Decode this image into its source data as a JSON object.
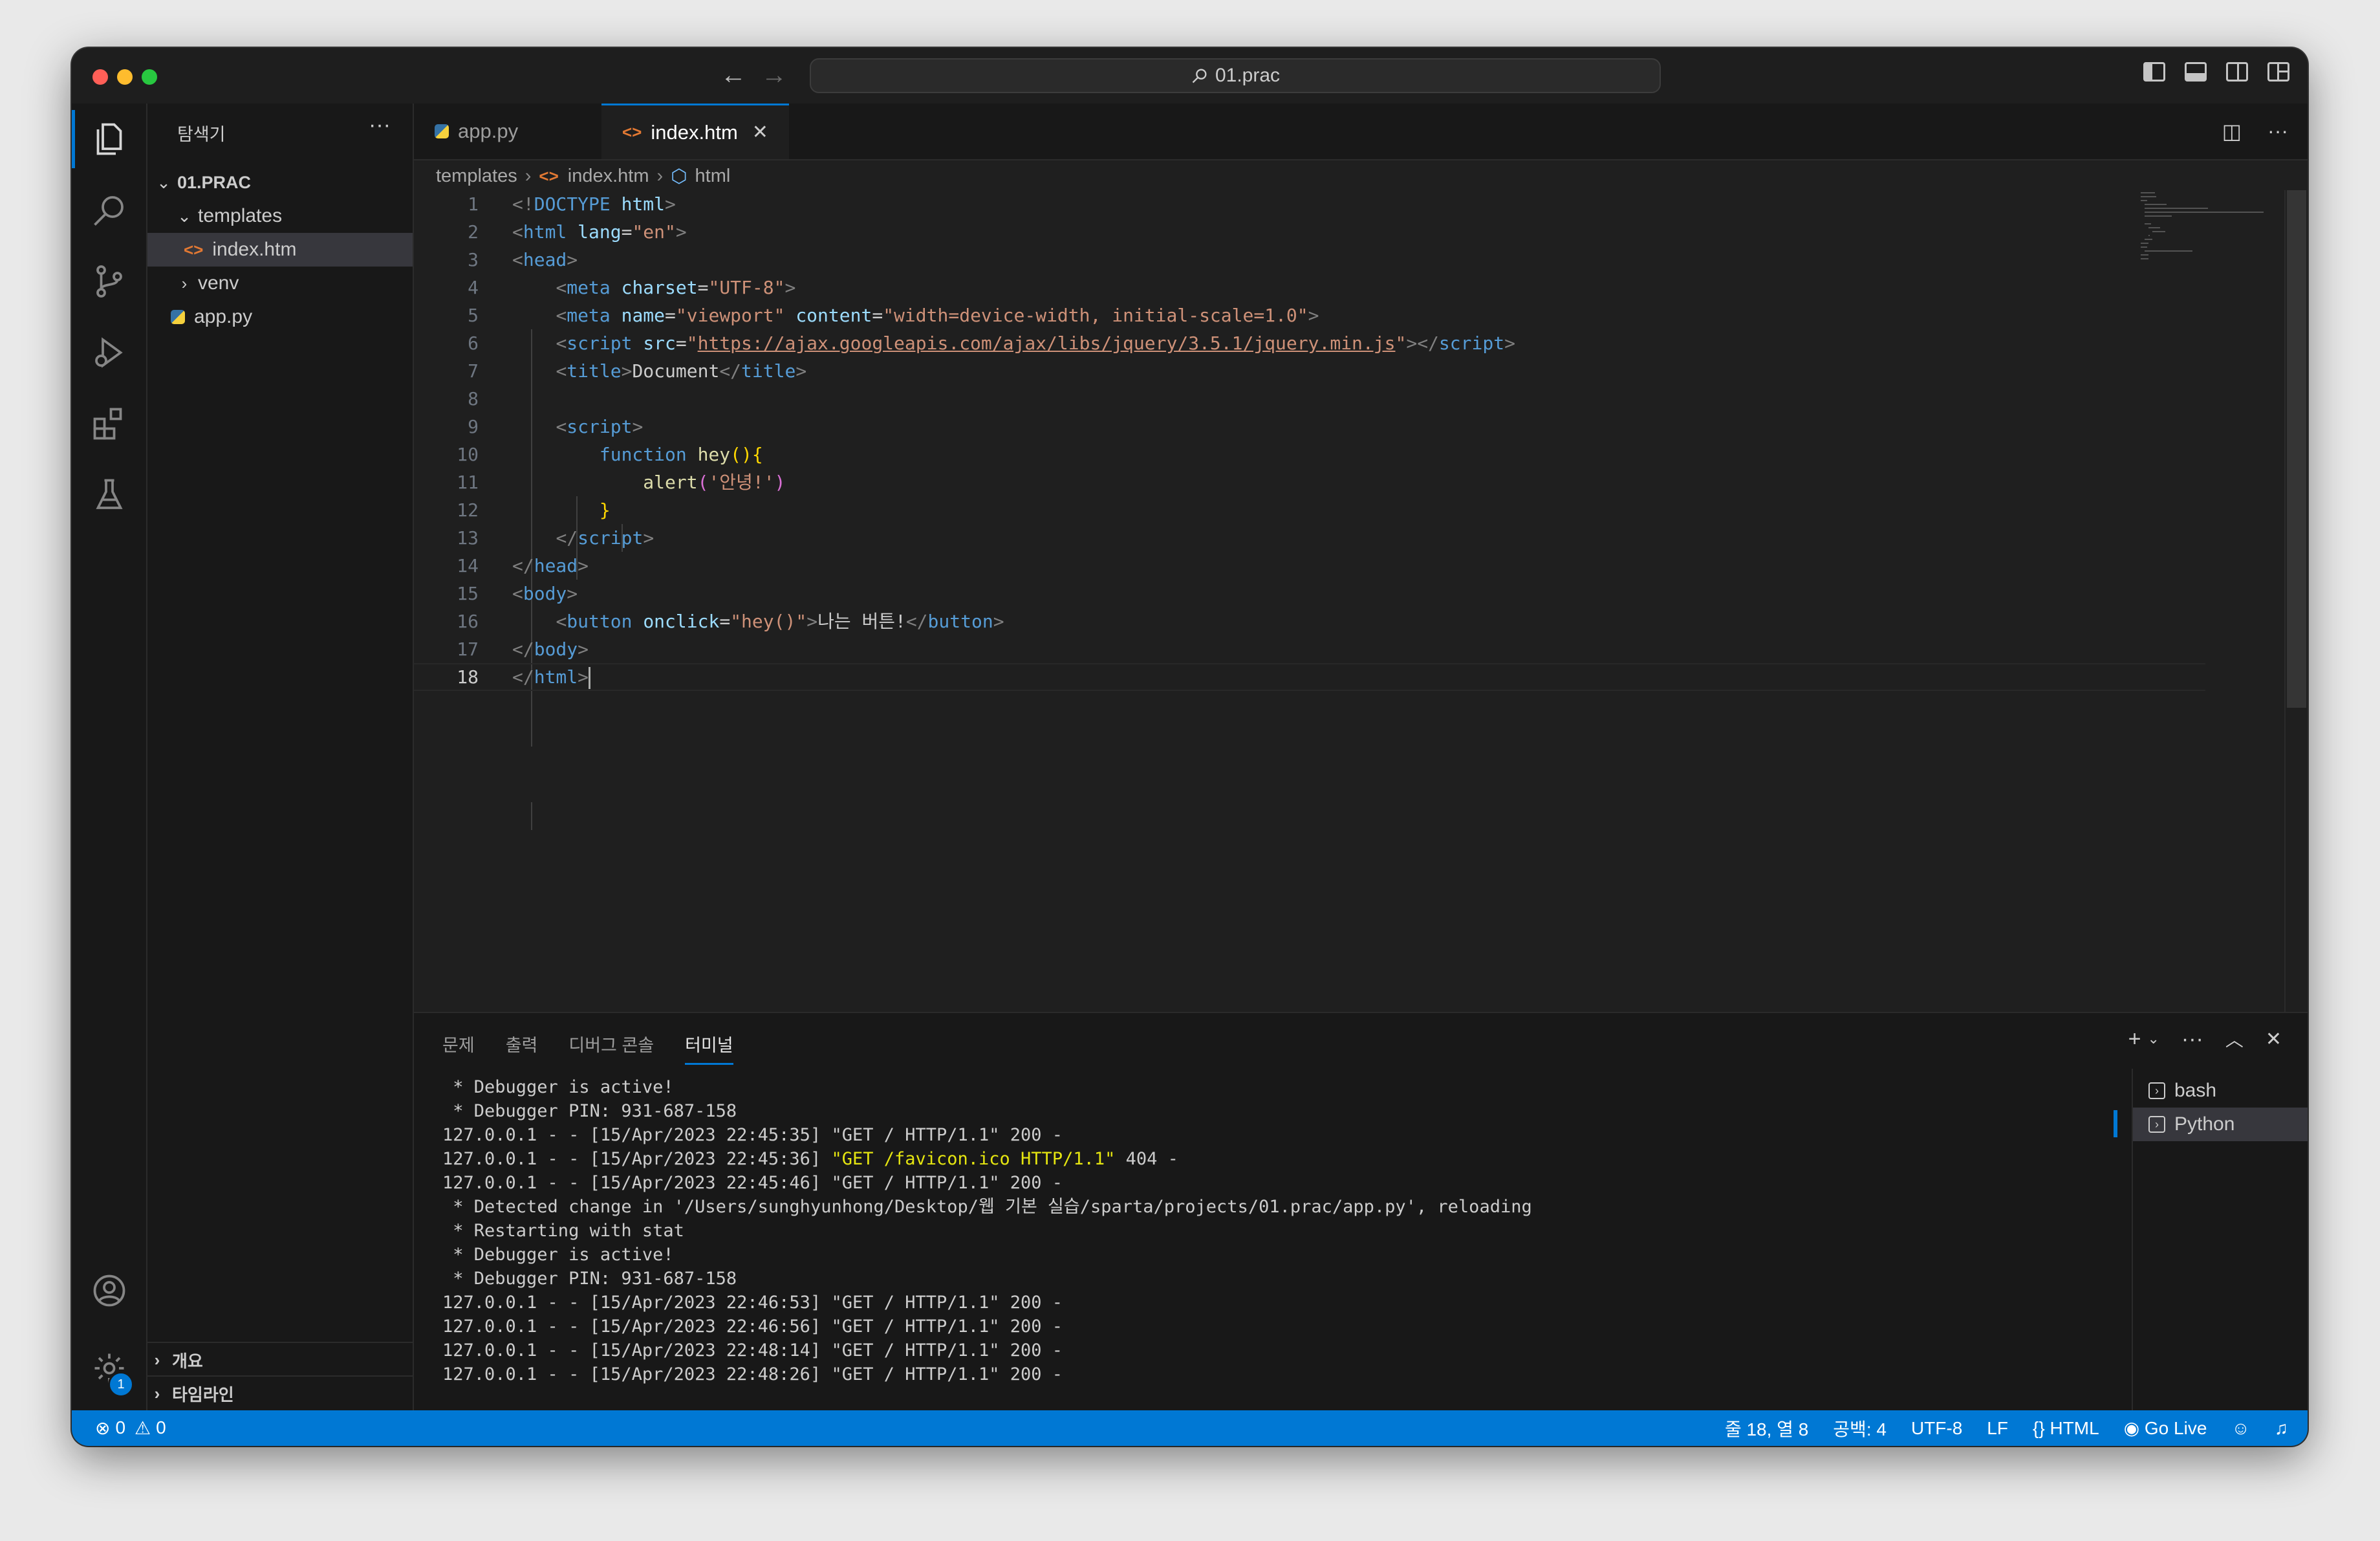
{
  "window": {
    "title": "01.prac"
  },
  "sidebar": {
    "header": "탐색기",
    "more": "···",
    "root": "01.PRAC",
    "tree": [
      {
        "label": "templates",
        "type": "folder-open"
      },
      {
        "label": "index.htm",
        "type": "html"
      },
      {
        "label": "venv",
        "type": "folder-closed"
      },
      {
        "label": "app.py",
        "type": "python"
      }
    ],
    "outline": "개요",
    "timeline": "타임라인"
  },
  "tabs": [
    {
      "label": "app.py",
      "active": false,
      "icon": "python-icon"
    },
    {
      "label": "index.htm",
      "active": true,
      "icon": "html-icon"
    }
  ],
  "breadcrumb": {
    "folder": "templates",
    "file": "index.htm",
    "symbol": "html"
  },
  "editor": {
    "current_line": 18,
    "line_numbers": [
      "1",
      "2",
      "3",
      "4",
      "5",
      "6",
      "7",
      "8",
      "9",
      "10",
      "11",
      "12",
      "13",
      "14",
      "15",
      "16",
      "17",
      "18"
    ],
    "code": {
      "doctype_open": "<!",
      "doctype_kw": "DOCTYPE",
      "doctype_attr": "html",
      "doctype_close": ">",
      "html_tag": "html",
      "lang_attr": "lang",
      "lang_val": "\"en\"",
      "head_tag": "head",
      "meta_tag": "meta",
      "charset_attr": "charset",
      "charset_val": "\"UTF-8\"",
      "name_attr": "name",
      "name_val": "\"viewport\"",
      "content_attr": "content",
      "content_val": "\"width=device-width, initial-scale=1.0\"",
      "script_tag": "script",
      "src_attr": "src",
      "src_q": "\"",
      "src_url": "https://ajax.googleapis.com/ajax/libs/jquery/3.5.1/jquery.min.js",
      "title_tag": "title",
      "title_text": "Document",
      "function_kw": "function",
      "func_name": "hey",
      "func_parens": "(){",
      "alert_call": "alert",
      "alert_arg": "'안녕!'",
      "close_brace": "}",
      "body_tag": "body",
      "button_tag": "button",
      "onclick_attr": "onclick",
      "onclick_val": "\"hey()\"",
      "button_text": "나는 버튼!"
    }
  },
  "panel": {
    "tabs": [
      "문제",
      "출력",
      "디버그 콘솔",
      "터미널"
    ],
    "active_tab": "터미널",
    "terminal_lines": [
      " * Debugger is active!",
      " * Debugger PIN: 931-687-158",
      "127.0.0.1 - - [15/Apr/2023 22:45:35] \"GET / HTTP/1.1\" 200 -",
      "127.0.0.1 - - [15/Apr/2023 22:45:36] ",
      "127.0.0.1 - - [15/Apr/2023 22:45:46] \"GET / HTTP/1.1\" 200 -",
      " * Detected change in '/Users/sunghyunhong/Desktop/웹 기본 실습/sparta/projects/01.prac/app.py', reloading",
      " * Restarting with stat",
      " * Debugger is active!",
      " * Debugger PIN: 931-687-158",
      "127.0.0.1 - - [15/Apr/2023 22:46:53] \"GET / HTTP/1.1\" 200 -",
      "127.0.0.1 - - [15/Apr/2023 22:46:56] \"GET / HTTP/1.1\" 200 -",
      "127.0.0.1 - - [15/Apr/2023 22:48:14] \"GET / HTTP/1.1\" 200 -",
      "127.0.0.1 - - [15/Apr/2023 22:48:26] \"GET / HTTP/1.1\" 200 -"
    ],
    "favicon_request": "\"GET /favicon.ico HTTP/1.1\"",
    "favicon_status": " 404 -",
    "terminals": [
      "bash",
      "Python"
    ]
  },
  "statusbar": {
    "errors": "0",
    "warnings": "0",
    "position": "줄 18, 열 8",
    "spaces": "공백: 4",
    "encoding": "UTF-8",
    "eol": "LF",
    "language": "HTML",
    "golive": "Go Live"
  },
  "settings_badge": "1",
  "colors": {
    "accent": "#0078d4",
    "editor_bg": "#1f1f1f",
    "sidebar_bg": "#181818",
    "statusbar_bg": "#0078d4"
  }
}
